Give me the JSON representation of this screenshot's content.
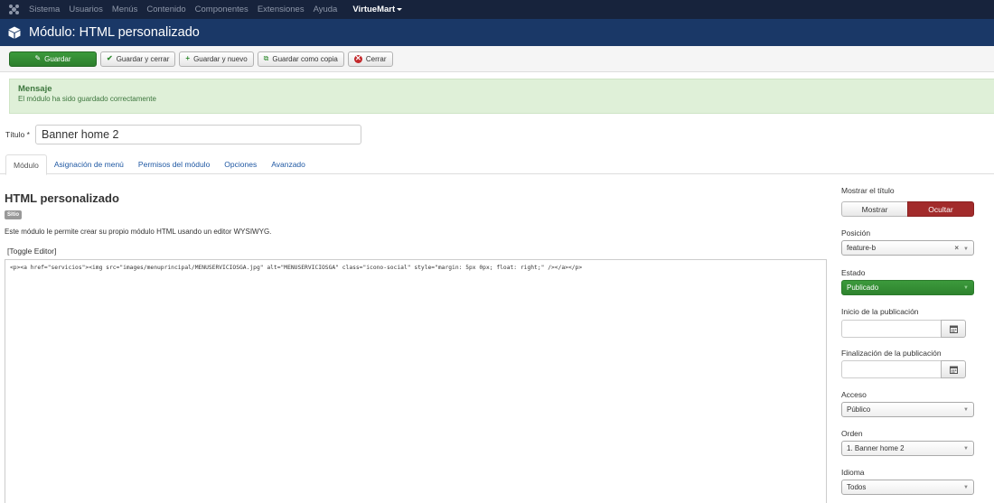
{
  "topbar": {
    "logo_icon": "joomla-logo-icon",
    "menu": [
      "Sistema",
      "Usuarios",
      "Menús",
      "Contenido",
      "Componentes",
      "Extensiones",
      "Ayuda"
    ],
    "virtuemart": "VirtueMart"
  },
  "titlebar": {
    "icon": "cube-icon",
    "title": "Módulo: HTML personalizado"
  },
  "toolbar": {
    "save": "Guardar",
    "save_close": "Guardar y cerrar",
    "save_new": "Guardar y nuevo",
    "save_copy": "Guardar como copia",
    "close": "Cerrar"
  },
  "message": {
    "heading": "Mensaje",
    "text": "El módulo ha sido guardado correctamente"
  },
  "title_field": {
    "label": "Título",
    "required": "*",
    "value": "Banner home 2"
  },
  "tabs": [
    "Módulo",
    "Asignación de menú",
    "Permisos del módulo",
    "Opciones",
    "Avanzado"
  ],
  "main": {
    "module_title": "HTML personalizado",
    "badge": "Sitio",
    "description": "Este módulo le permite crear su propio módulo HTML usando un editor WYSIWYG.",
    "toggle_editor": "[Toggle Editor]",
    "editor_content": "<p><a href=\"servicios\"><img src=\"images/menuprincipal/MENUSERVICIOSGA.jpg\" alt=\"MENUSERVICIOSGA\" class=\"icono-social\" style=\"margin: 5px 0px; float: right;\" /></a></p>"
  },
  "side": {
    "show_title_label": "Mostrar el título",
    "show": "Mostrar",
    "hide": "Ocultar",
    "position_label": "Posición",
    "position_value": "feature-b",
    "status_label": "Estado",
    "status_value": "Publicado",
    "publish_start_label": "Inicio de la publicación",
    "publish_end_label": "Finalización de la publicación",
    "access_label": "Acceso",
    "access_value": "Público",
    "order_label": "Orden",
    "order_value": "1. Banner home 2",
    "language_label": "Idioma",
    "language_value": "Todos"
  }
}
